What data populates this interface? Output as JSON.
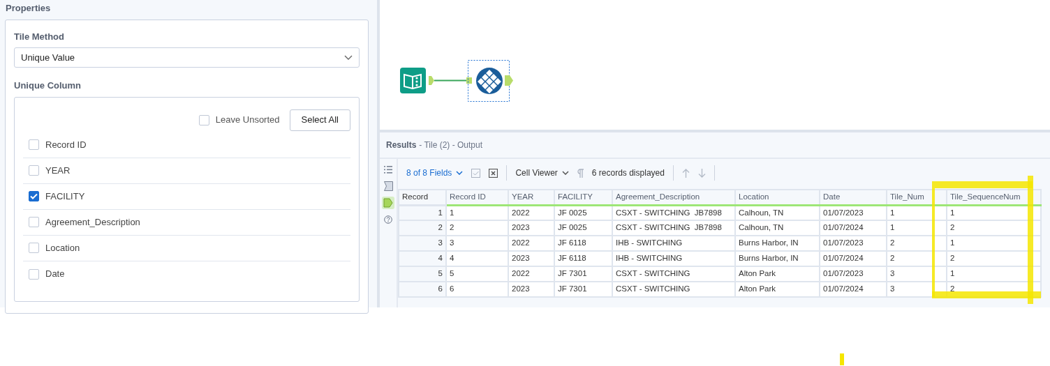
{
  "properties": {
    "title": "Properties",
    "tile_method": {
      "label": "Tile Method",
      "value": "Unique Value"
    },
    "unique_column": {
      "label": "Unique Column",
      "leave_unsorted": {
        "label": "Leave Unsorted",
        "checked": false
      },
      "select_all": "Select All",
      "columns": [
        {
          "label": "Record ID",
          "checked": false
        },
        {
          "label": "YEAR",
          "checked": false
        },
        {
          "label": "FACILITY",
          "checked": true
        },
        {
          "label": "Agreement_Description",
          "checked": false
        },
        {
          "label": "Location",
          "checked": false
        },
        {
          "label": "Date",
          "checked": false
        }
      ]
    }
  },
  "results": {
    "title": "Results",
    "subtitle": "- Tile (2) - Output",
    "side_tools": [
      {
        "kind": "list",
        "selected": false
      },
      {
        "kind": "metadata",
        "selected": false
      },
      {
        "kind": "data",
        "selected": true
      },
      {
        "kind": "help",
        "selected": false
      }
    ],
    "fields": "8 of 8 Fields",
    "viewer": "Cell Viewer",
    "records": "6 records displayed",
    "table": {
      "columns": [
        "Record",
        "Record ID",
        "YEAR",
        "FACILITY",
        "Agreement_Description",
        "Location",
        "Date",
        "Tile_Num",
        "Tile_SequenceNum"
      ],
      "rows": [
        [
          "1",
          "1",
          "2022",
          "JF 0025",
          "CSXT - SWITCHING  JB7898",
          "Calhoun, TN",
          "01/07/2023",
          "1",
          "1"
        ],
        [
          "2",
          "2",
          "2023",
          "JF 0025",
          "CSXT - SWITCHING  JB7898",
          "Calhoun, TN",
          "01/07/2024",
          "1",
          "2"
        ],
        [
          "3",
          "3",
          "2022",
          "JF 6118",
          "IHB - SWITCHING",
          "Burns Harbor, IN",
          "01/07/2023",
          "2",
          "1"
        ],
        [
          "4",
          "4",
          "2023",
          "JF 6118",
          "IHB - SWITCHING",
          "Burns Harbor, IN",
          "01/07/2024",
          "2",
          "2"
        ],
        [
          "5",
          "5",
          "2022",
          "JF 7301",
          "CSXT - SWITCHING",
          "Alton Park",
          "01/07/2023",
          "3",
          "1"
        ],
        [
          "6",
          "6",
          "2023",
          "JF 7301",
          "CSXT - SWITCHING",
          "Alton Park",
          "01/07/2024",
          "3",
          "2"
        ]
      ]
    }
  }
}
